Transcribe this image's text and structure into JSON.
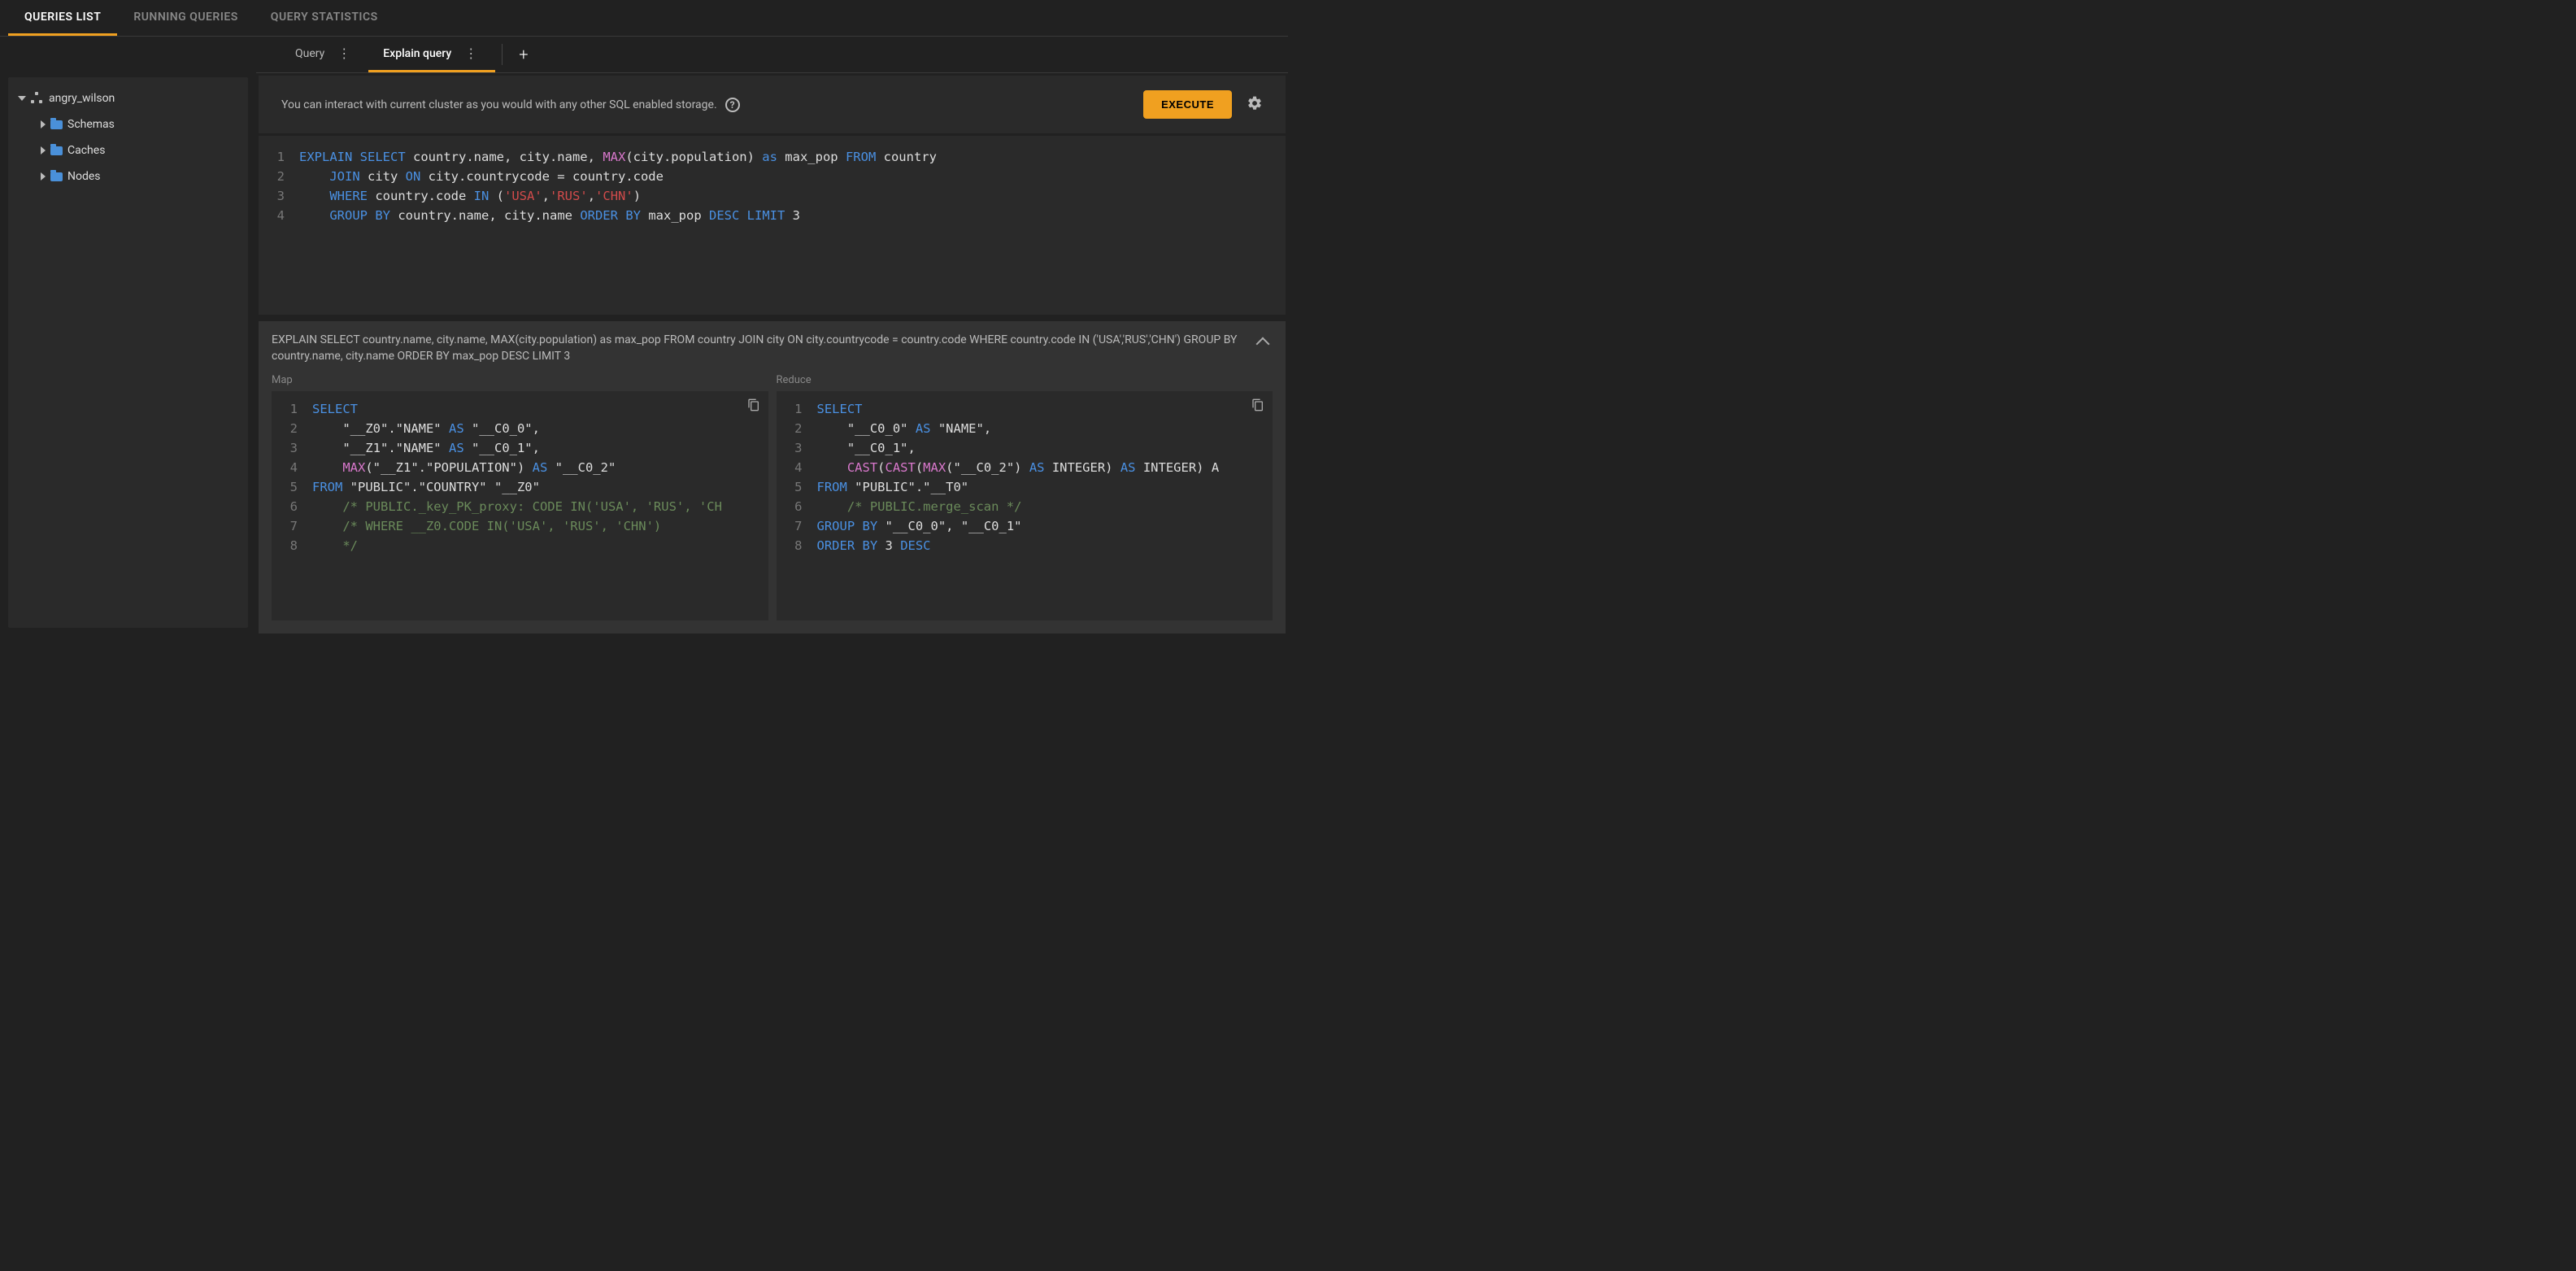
{
  "top_tabs": {
    "queries_list": "QUERIES LIST",
    "running_queries": "RUNNING QUERIES",
    "query_statistics": "QUERY STATISTICS"
  },
  "sidebar": {
    "cluster": "angry_wilson",
    "schemas": "Schemas",
    "caches": "Caches",
    "nodes": "Nodes"
  },
  "query_tabs": {
    "query": "Query",
    "explain": "Explain query"
  },
  "info": {
    "text": "You can interact with current cluster as you would with any other SQL enabled storage.",
    "execute": "EXECUTE",
    "help": "?"
  },
  "editor": {
    "line1": {
      "a": "EXPLAIN",
      "b": "SELECT",
      "c": " country.name, city.name, ",
      "d": "MAX",
      "e": "(city.population) ",
      "f": "as",
      "g": " max_pop ",
      "h": "FROM",
      "i": " country"
    },
    "line2": {
      "a": "JOIN",
      "b": " city ",
      "c": "ON",
      "d": " city.countrycode = country.code"
    },
    "line3": {
      "a": "WHERE",
      "b": " country.code ",
      "c": "IN",
      "d": " (",
      "e": "'USA'",
      "f": ",",
      "g": "'RUS'",
      "h": ",",
      "i": "'CHN'",
      "j": ")"
    },
    "line4": {
      "a": "GROUP",
      "b": "BY",
      "c": " country.name, city.name ",
      "d": "ORDER",
      "e": "BY",
      "f": " max_pop ",
      "g": "DESC",
      "h": "LIMIT",
      "i": " 3"
    }
  },
  "result": {
    "text": "EXPLAIN SELECT country.name, city.name, MAX(city.population) as max_pop FROM country JOIN city ON city.countrycode = country.code WHERE country.code IN ('USA','RUS','CHN') GROUP BY country.name, city.name ORDER BY max_pop DESC LIMIT 3"
  },
  "map": {
    "label": "Map",
    "l1": {
      "a": "SELECT"
    },
    "l2": {
      "a": "    \"__Z0\".\"NAME\" ",
      "b": "AS",
      "c": " \"__C0_0\","
    },
    "l3": {
      "a": "    \"__Z1\".\"NAME\" ",
      "b": "AS",
      "c": " \"__C0_1\","
    },
    "l4": {
      "a": "    ",
      "b": "MAX",
      "c": "(\"__Z1\".\"POPULATION\") ",
      "d": "AS",
      "e": " \"__C0_2\""
    },
    "l5": {
      "a": "FROM",
      "b": " \"PUBLIC\".\"COUNTRY\" \"__Z0\""
    },
    "l6": {
      "a": "    /* PUBLIC._key_PK_proxy: CODE IN('USA', 'RUS', 'CH"
    },
    "l7": {
      "a": "    /* WHERE __Z0.CODE IN('USA', 'RUS', 'CHN')"
    },
    "l8": {
      "a": "    */"
    }
  },
  "reduce": {
    "label": "Reduce",
    "l1": {
      "a": "SELECT"
    },
    "l2": {
      "a": "    \"__C0_0\" ",
      "b": "AS",
      "c": " \"NAME\","
    },
    "l3": {
      "a": "    \"__C0_1\","
    },
    "l4": {
      "a": "    ",
      "b": "CAST",
      "c": "(",
      "d": "CAST",
      "e": "(",
      "f": "MAX",
      "g": "(\"__C0_2\") ",
      "h": "AS",
      "i": " INTEGER) ",
      "j": "AS",
      "k": " INTEGER) A"
    },
    "l5": {
      "a": "FROM",
      "b": " \"PUBLIC\".\"__T0\""
    },
    "l6": {
      "a": "    /* PUBLIC.merge_scan */"
    },
    "l7": {
      "a": "GROUP",
      "b": "BY",
      "c": " \"__C0_0\", \"__C0_1\""
    },
    "l8": {
      "a": "ORDER",
      "b": "BY",
      "c": " 3 ",
      "d": "DESC"
    }
  },
  "ln": {
    "1": "1",
    "2": "2",
    "3": "3",
    "4": "4",
    "5": "5",
    "6": "6",
    "7": "7",
    "8": "8"
  }
}
